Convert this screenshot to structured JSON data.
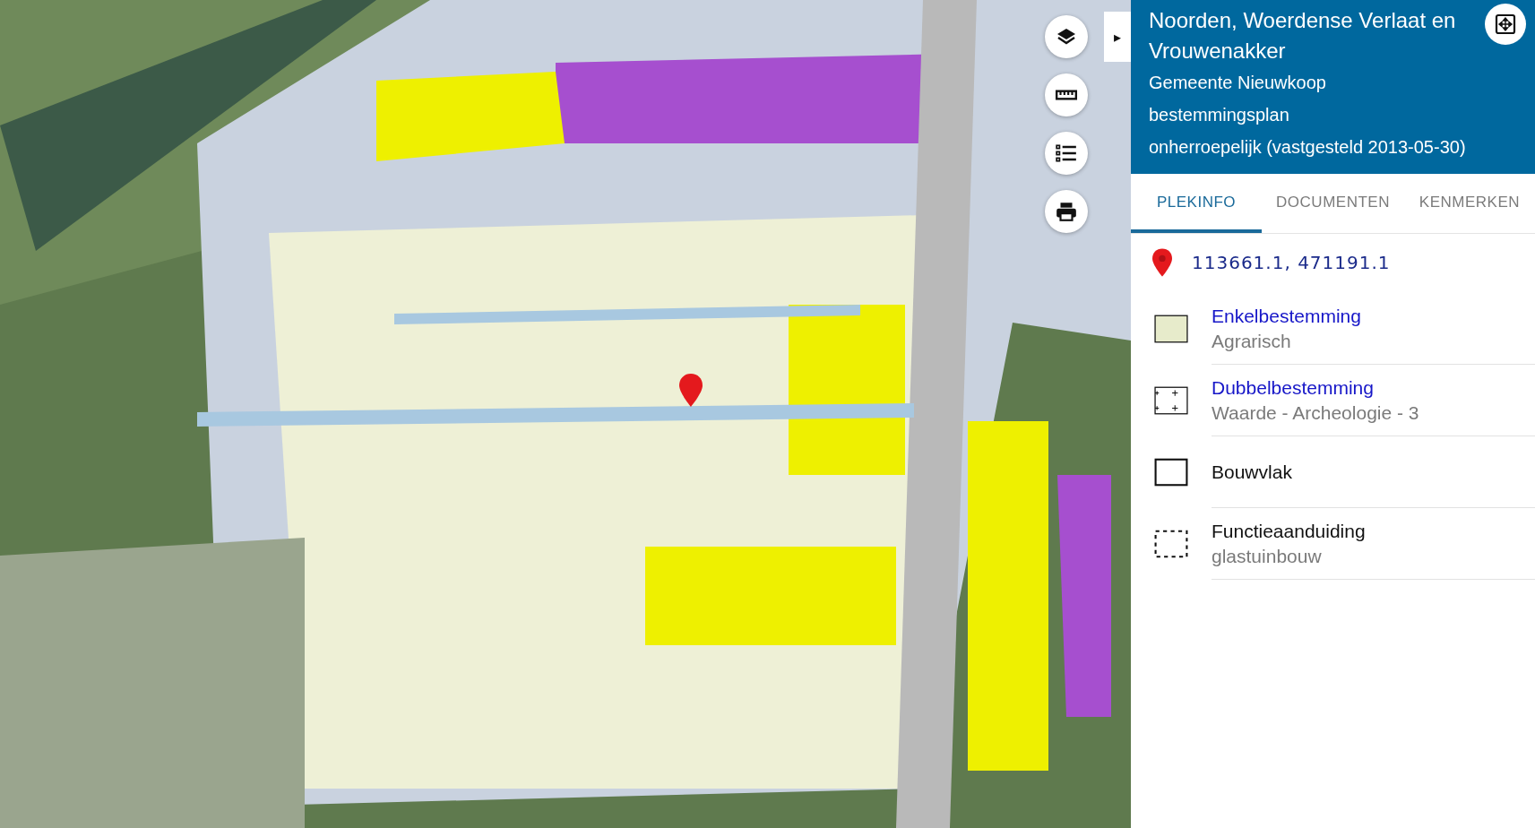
{
  "map": {
    "controls": [
      {
        "kind": "layers"
      },
      {
        "kind": "ruler"
      },
      {
        "kind": "legend"
      },
      {
        "kind": "print"
      }
    ],
    "collapse_toggle": "▸"
  },
  "panel": {
    "title": "Noorden, Woerdense Verlaat en Vrouwenakker",
    "lines": [
      "Gemeente Nieuwkoop",
      "bestemmingsplan",
      "onherroepelijk (vastgesteld 2013-05-30)"
    ],
    "tabs": [
      {
        "label": "PLEKINFO",
        "selected": true
      },
      {
        "label": "DOCUMENTEN",
        "selected": false
      },
      {
        "label": "KENMERKEN",
        "selected": false
      }
    ],
    "coordinates": "113661.1, 471191.1",
    "legend": [
      {
        "kind": "fill",
        "title": "Enkelbestemming",
        "linked": true,
        "subtitle": "Agrarisch"
      },
      {
        "kind": "crosses",
        "title": "Dubbelbestemming",
        "linked": true,
        "subtitle": "Waarde - Archeologie - 3"
      },
      {
        "kind": "outline",
        "title": "Bouwvlak",
        "linked": false
      },
      {
        "kind": "dashed",
        "title": "Functieaanduiding",
        "linked": false,
        "subtitle": "glastuinbouw"
      }
    ]
  }
}
